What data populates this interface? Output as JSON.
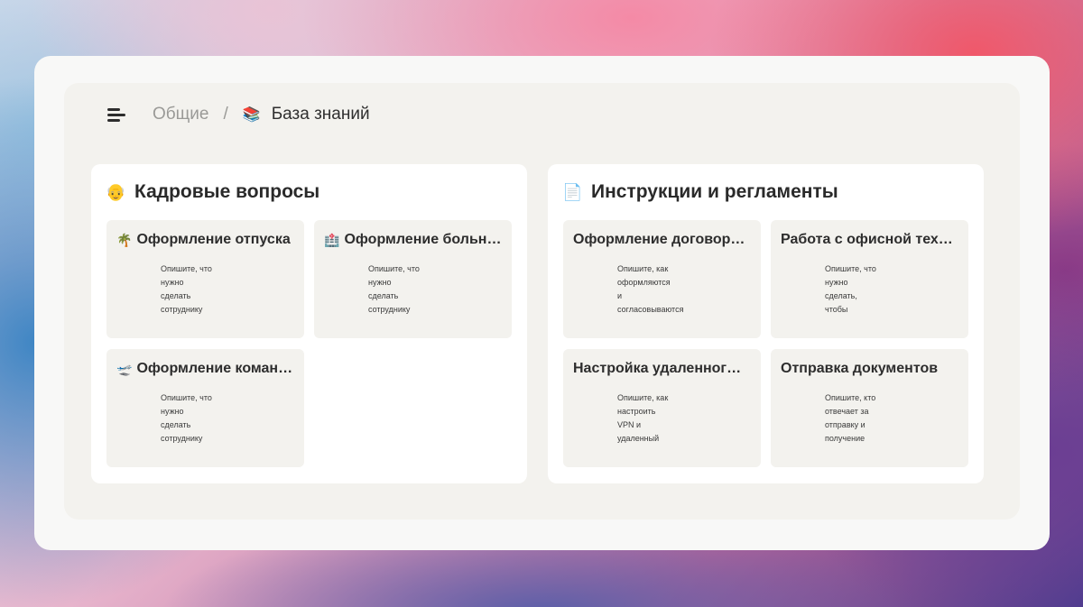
{
  "breadcrumb": {
    "parent": "Общие",
    "separator": "/",
    "current_emoji": "📚",
    "current": "База знаний"
  },
  "panels": [
    {
      "emoji": "👴",
      "title": "Кадровые вопросы",
      "cards": [
        {
          "emoji": "🌴",
          "title": "Оформление отпуска",
          "desc": [
            "Опишите, что",
            "нужно",
            "сделать",
            "сотруднику"
          ]
        },
        {
          "emoji": "🏥",
          "title": "Оформление больн…",
          "desc": [
            "Опишите, что",
            "нужно",
            "сделать",
            "сотруднику"
          ]
        },
        {
          "emoji": "🛫",
          "title": "Оформление коман…",
          "desc": [
            "Опишите, что",
            "нужно",
            "сделать",
            "сотруднику"
          ]
        }
      ]
    },
    {
      "emoji": "📄",
      "title": "Инструкции и регламенты",
      "cards": [
        {
          "title": "Оформление договор…",
          "desc": [
            "Опишите, как",
            "оформляются",
            "и",
            "согласовываются"
          ]
        },
        {
          "title": "Работа с офисной тех…",
          "desc": [
            "Опишите, что",
            "нужно",
            "сделать,",
            "чтобы"
          ]
        },
        {
          "title": "Настройка удаленног…",
          "desc": [
            "Опишите, как",
            "настроить",
            "VPN и",
            "удаленный"
          ]
        },
        {
          "title": "Отправка документов",
          "desc": [
            "Опишите, кто",
            "отвечает за",
            "отправку и",
            "получение"
          ]
        }
      ]
    }
  ]
}
